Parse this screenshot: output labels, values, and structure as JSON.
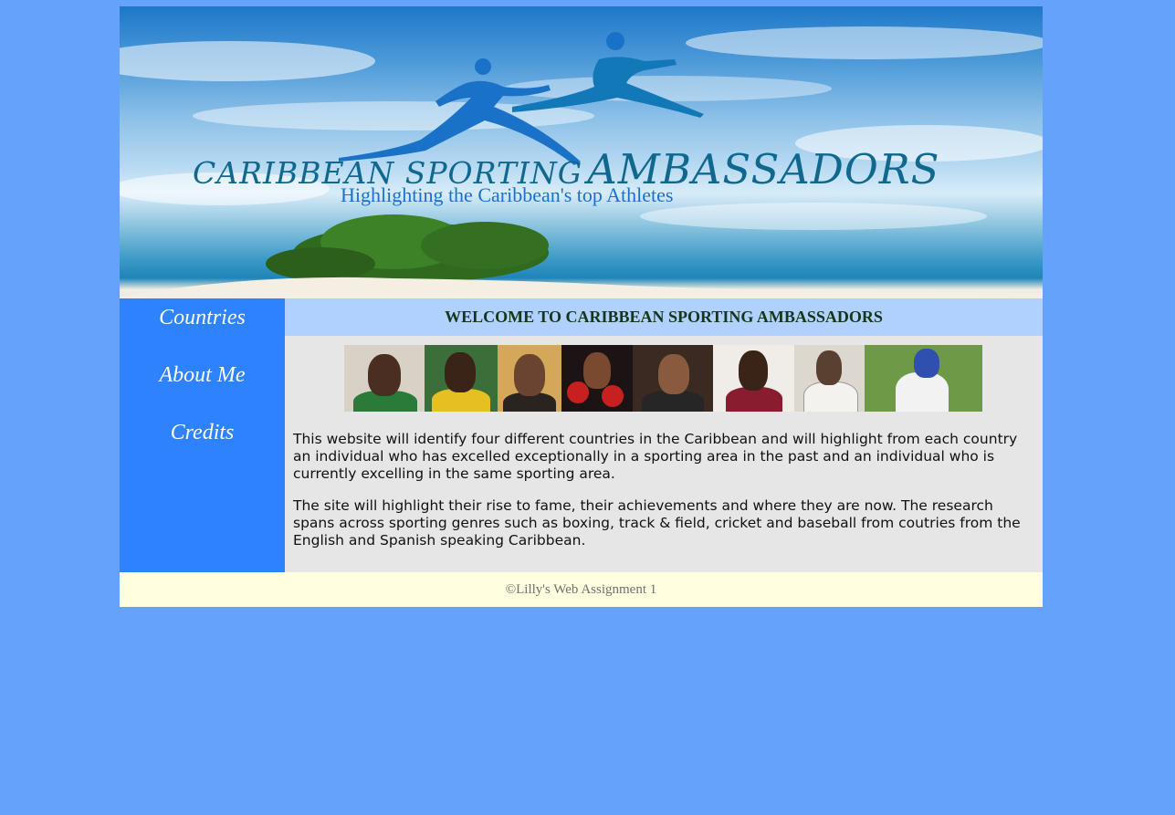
{
  "banner": {
    "title_small": "CARIBBEAN SPORTING",
    "title_big": "AMBASSADORS",
    "subtitle": "Highlighting the Caribbean's top Athletes"
  },
  "nav": {
    "items": [
      {
        "label": "Countries"
      },
      {
        "label": "About Me"
      },
      {
        "label": "Credits"
      }
    ]
  },
  "main": {
    "heading": "WELCOME TO CARIBBEAN SPORTING AMBASSADORS",
    "paragraphs": [
      "This website will identify four different countries in the Caribbean and will highlight from each country an individual who has excelled exceptionally in a sporting area in the past and an individual who is currently excelling in the same sporting area.",
      "The site will highlight their rise to fame, their achievements and where they are now. The research spans across sporting genres such as boxing, track & field, cricket and baseball from coutries from the English and Spanish speaking Caribbean."
    ]
  },
  "footer": {
    "text": "©Lilly's Web Assignment 1"
  },
  "colors": {
    "page_background": "#64a2fc",
    "sidebar": "#2f82fd",
    "welcome_bar": "#b0d0fd",
    "content_background": "#e6e6e6",
    "footer_background": "#ffffe0"
  },
  "icons": {
    "banner_logo": "runner-figures-icon"
  }
}
